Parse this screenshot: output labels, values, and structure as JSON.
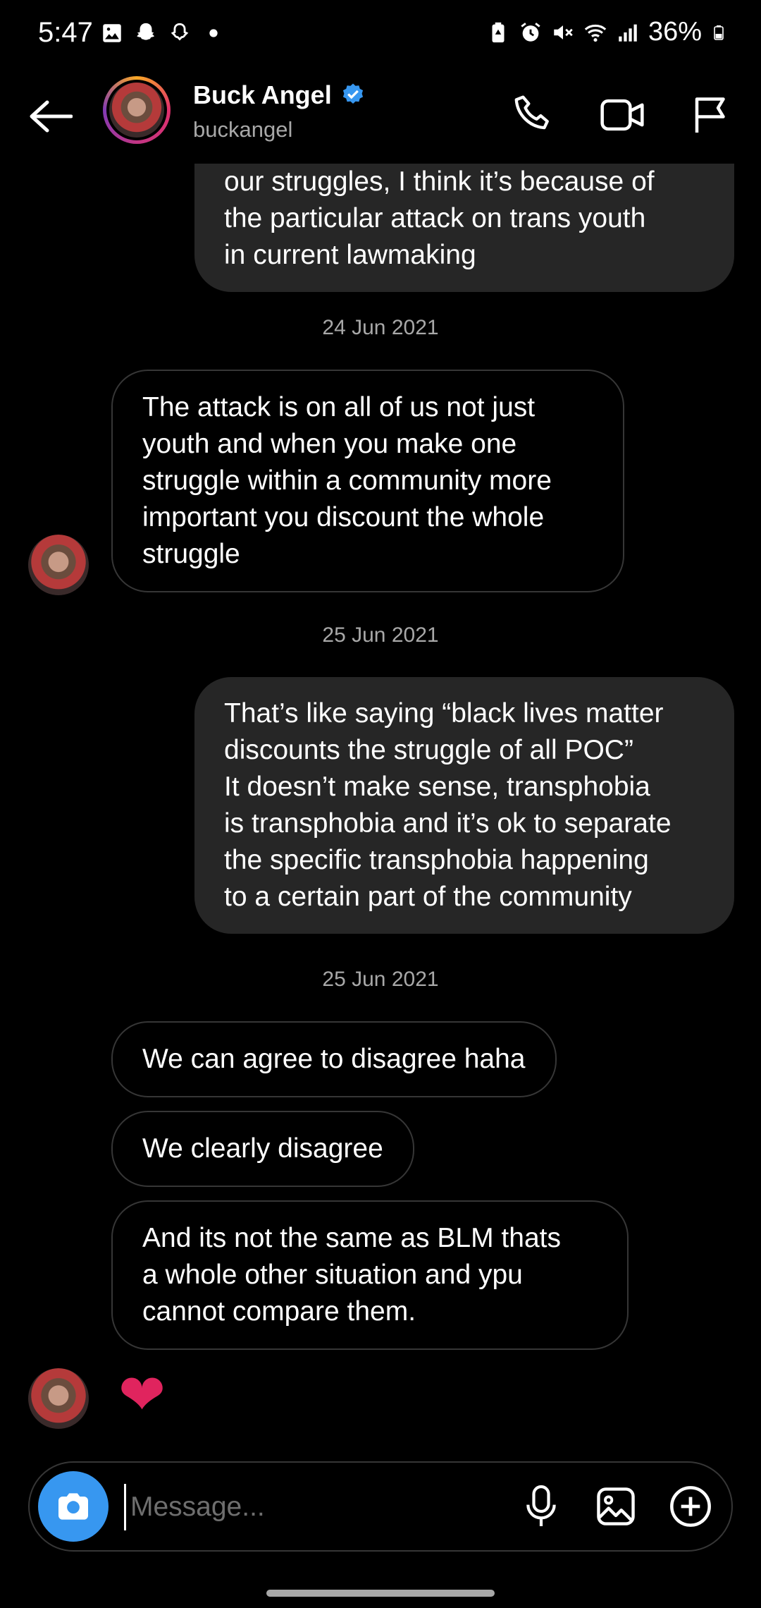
{
  "status_bar": {
    "time": "5:47",
    "battery": "36%",
    "left_icons": [
      "gallery-icon",
      "snapchat-icon",
      "snapchat-icon",
      "dot-icon"
    ],
    "right_icons": [
      "battery-saver-icon",
      "alarm-icon",
      "mute-icon",
      "wifi-icon",
      "signal-icon",
      "battery-icon"
    ]
  },
  "header": {
    "name": "Buck Angel",
    "username": "buckangel",
    "verified": true
  },
  "messages": [
    {
      "direction": "out",
      "text": "our struggles, I think it’s because of\nthe particular attack on trans youth\nin current lawmaking"
    },
    {
      "type": "date",
      "text": "24 Jun 2021"
    },
    {
      "direction": "in",
      "text": "The attack is on all of us not just\nyouth and when you make one\nstruggle within a community more\nimportant you discount the whole\nstruggle"
    },
    {
      "type": "date",
      "text": "25 Jun 2021"
    },
    {
      "direction": "out",
      "text": "That’s like saying “black lives matter\ndiscounts the struggle of all POC”\nIt doesn’t make sense, transphobia\nis transphobia and it’s ok to separate\nthe specific transphobia happening\nto a certain part of the community"
    },
    {
      "type": "date",
      "text": "25 Jun 2021"
    },
    {
      "direction": "in",
      "text": "We can agree to disagree haha"
    },
    {
      "direction": "in",
      "text": "We clearly disagree"
    },
    {
      "direction": "in",
      "text": "And its not the same as BLM thats\na whole other situation and ypu\ncannot compare them."
    },
    {
      "direction": "in",
      "type": "emoji",
      "text": "❤"
    }
  ],
  "composer": {
    "placeholder": "Message...",
    "value": ""
  },
  "colors": {
    "accent": "#3797f0",
    "outgoing_bubble": "#262626",
    "heart": "#e0245e"
  }
}
